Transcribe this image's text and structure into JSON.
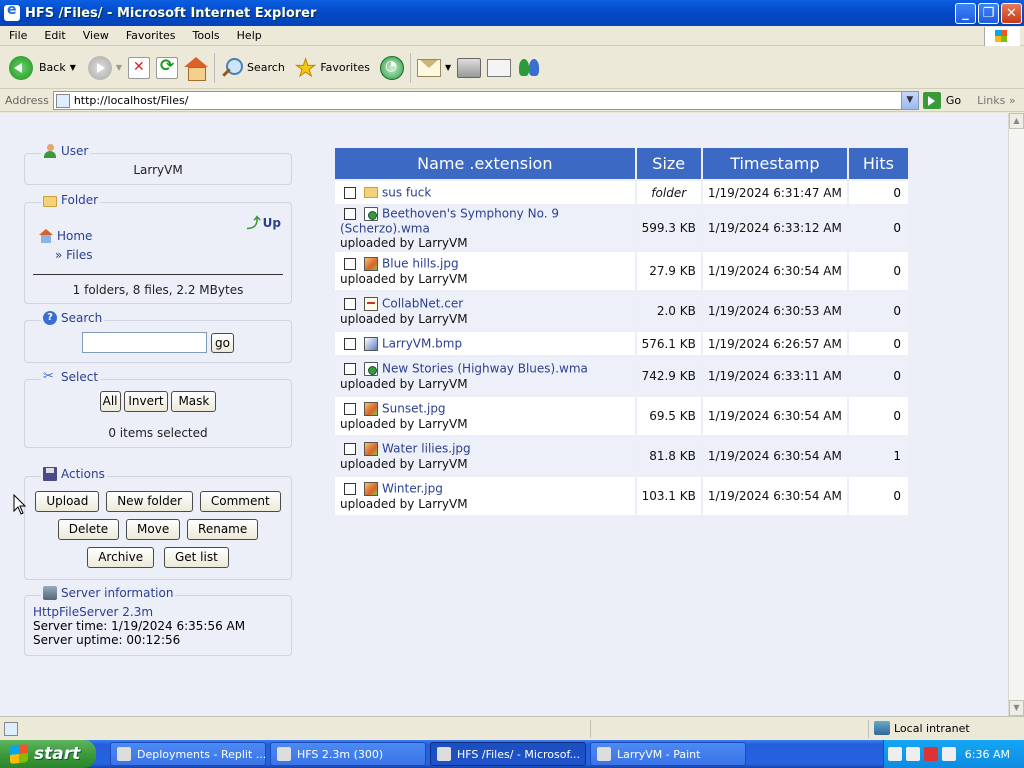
{
  "window": {
    "title": "HFS /Files/ - Microsoft Internet Explorer"
  },
  "menu": [
    "File",
    "Edit",
    "View",
    "Favorites",
    "Tools",
    "Help"
  ],
  "toolbar": {
    "back": "Back",
    "search": "Search",
    "favorites": "Favorites"
  },
  "address": {
    "label": "Address",
    "url": "http://localhost/Files/",
    "go": "Go",
    "links": "Links"
  },
  "user": {
    "header": "User",
    "name": "LarryVM"
  },
  "folder": {
    "header": "Folder",
    "up": "Up",
    "home": "Home",
    "current": "» Files",
    "summary": "1 folders, 8 files, 2.2 MBytes"
  },
  "search": {
    "header": "Search",
    "value": "",
    "go": "go"
  },
  "select": {
    "header": "Select",
    "all": "All",
    "invert": "Invert",
    "mask": "Mask",
    "status": "0 items selected"
  },
  "actions": {
    "header": "Actions",
    "upload": "Upload",
    "new_folder": "New folder",
    "comment": "Comment",
    "delete": "Delete",
    "move": "Move",
    "rename": "Rename",
    "archive": "Archive",
    "get_list": "Get list"
  },
  "server": {
    "header": "Server information",
    "software": "HttpFileServer 2.3m",
    "time": "Server time: 1/19/2024 6:35:56 AM",
    "uptime": "Server uptime: 00:12:56"
  },
  "table": {
    "headers": [
      "Name .extension",
      "Size",
      "Timestamp",
      "Hits"
    ],
    "rows": [
      {
        "name": "sus fuck",
        "icon": "folder-icon",
        "uploaded": "",
        "size": "folder",
        "timestamp": "1/19/2024 6:31:47 AM",
        "hits": "0"
      },
      {
        "name": "Beethoven's Symphony No. 9 (Scherzo).wma",
        "icon": "audio-file-icon",
        "uploaded": "uploaded by LarryVM",
        "size": "599.3 KB",
        "timestamp": "1/19/2024 6:33:12 AM",
        "hits": "0"
      },
      {
        "name": "Blue hills.jpg",
        "icon": "image-file-icon",
        "uploaded": "uploaded by LarryVM",
        "size": "27.9 KB",
        "timestamp": "1/19/2024 6:30:54 AM",
        "hits": "0"
      },
      {
        "name": "CollabNet.cer",
        "icon": "certificate-file-icon",
        "uploaded": "uploaded by LarryVM",
        "size": "2.0 KB",
        "timestamp": "1/19/2024 6:30:53 AM",
        "hits": "0"
      },
      {
        "name": "LarryVM.bmp",
        "icon": "bitmap-file-icon",
        "uploaded": "",
        "size": "576.1 KB",
        "timestamp": "1/19/2024 6:26:57 AM",
        "hits": "0"
      },
      {
        "name": "New Stories (Highway Blues).wma",
        "icon": "audio-file-icon",
        "uploaded": "uploaded by LarryVM",
        "size": "742.9 KB",
        "timestamp": "1/19/2024 6:33:11 AM",
        "hits": "0"
      },
      {
        "name": "Sunset.jpg",
        "icon": "image-file-icon",
        "uploaded": "uploaded by LarryVM",
        "size": "69.5 KB",
        "timestamp": "1/19/2024 6:30:54 AM",
        "hits": "0"
      },
      {
        "name": "Water lilies.jpg",
        "icon": "image-file-icon",
        "uploaded": "uploaded by LarryVM",
        "size": "81.8 KB",
        "timestamp": "1/19/2024 6:30:54 AM",
        "hits": "1"
      },
      {
        "name": "Winter.jpg",
        "icon": "image-file-icon",
        "uploaded": "uploaded by LarryVM",
        "size": "103.1 KB",
        "timestamp": "1/19/2024 6:30:54 AM",
        "hits": "0"
      }
    ]
  },
  "status": {
    "zone": "Local intranet"
  },
  "taskbar": {
    "start": "start",
    "tasks": [
      "Deployments - Replit ...",
      "HFS 2.3m (300)",
      "HFS /Files/ - Microsof...",
      "LarryVM - Paint"
    ],
    "clock": "6:36 AM"
  }
}
